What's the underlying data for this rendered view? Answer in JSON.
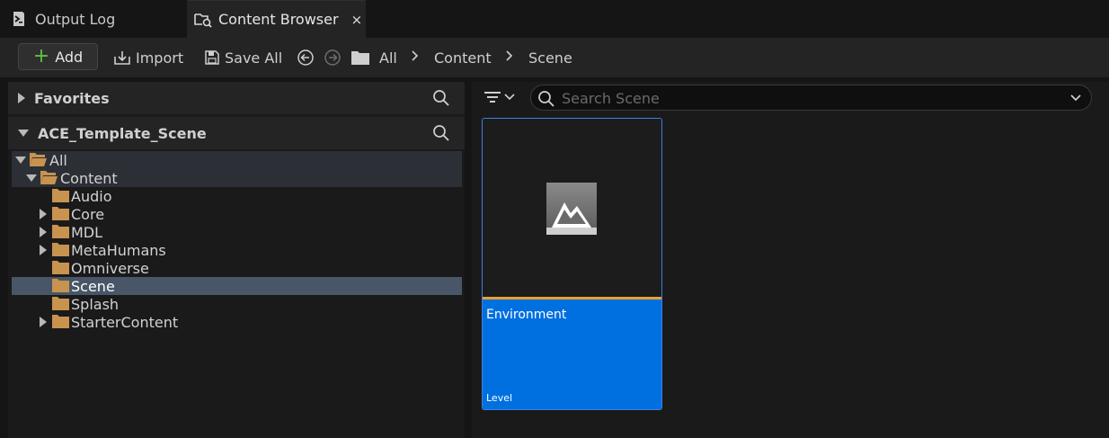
{
  "tabs": {
    "output_log": "Output Log",
    "content_browser": "Content Browser",
    "close_glyph": "×"
  },
  "toolbar": {
    "add_label": "Add",
    "import_label": "Import",
    "save_all_label": "Save All"
  },
  "breadcrumb": [
    "All",
    "Content",
    "Scene"
  ],
  "favorites": {
    "label": "Favorites"
  },
  "project": {
    "label": "ACE_Template_Scene"
  },
  "tree": [
    {
      "label": "All",
      "state": "expanded"
    },
    {
      "label": "Content",
      "state": "expanded"
    },
    {
      "label": "Audio",
      "state": "leaf"
    },
    {
      "label": "Core",
      "state": "collapsed"
    },
    {
      "label": "MDL",
      "state": "collapsed"
    },
    {
      "label": "MetaHumans",
      "state": "collapsed"
    },
    {
      "label": "Omniverse",
      "state": "leaf"
    },
    {
      "label": "Scene",
      "state": "leaf"
    },
    {
      "label": "Splash",
      "state": "leaf"
    },
    {
      "label": "StarterContent",
      "state": "collapsed"
    }
  ],
  "search": {
    "placeholder": "Search Scene",
    "value": ""
  },
  "assets": [
    {
      "name": "Environment",
      "type": "Level"
    }
  ],
  "colors": {
    "accent_blue": "#0070e0",
    "level_bar": "#e9a030",
    "folder": "#c8934f",
    "selected_row": "#485668",
    "add_plus": "#5fbf4a"
  }
}
